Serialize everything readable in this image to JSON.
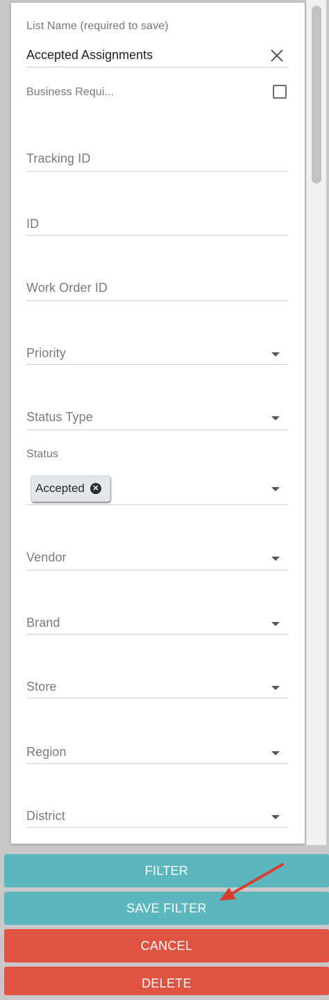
{
  "form": {
    "list_name_label": "List Name (required to save)",
    "list_name_value": "Accepted Assignments",
    "business_required_label": "Business Requi...",
    "fields": {
      "tracking_id": "Tracking ID",
      "id": "ID",
      "work_order_id": "Work Order ID",
      "priority": "Priority",
      "status_type": "Status Type",
      "status_label": "Status",
      "status_chip": "Accepted",
      "vendor": "Vendor",
      "brand": "Brand",
      "store": "Store",
      "region": "Region",
      "district": "District"
    }
  },
  "buttons": {
    "filter": "FILTER",
    "save_filter": "SAVE FILTER",
    "cancel": "CANCEL",
    "delete": "DELETE"
  },
  "colors": {
    "teal": "#5bb7bd",
    "red": "#e05342",
    "annotation_arrow": "#d6402e"
  },
  "icons": {
    "clear": "close-icon",
    "dropdown": "chevron-down-icon",
    "chip_remove": "remove-chip-icon",
    "checkbox": "checkbox-icon"
  }
}
